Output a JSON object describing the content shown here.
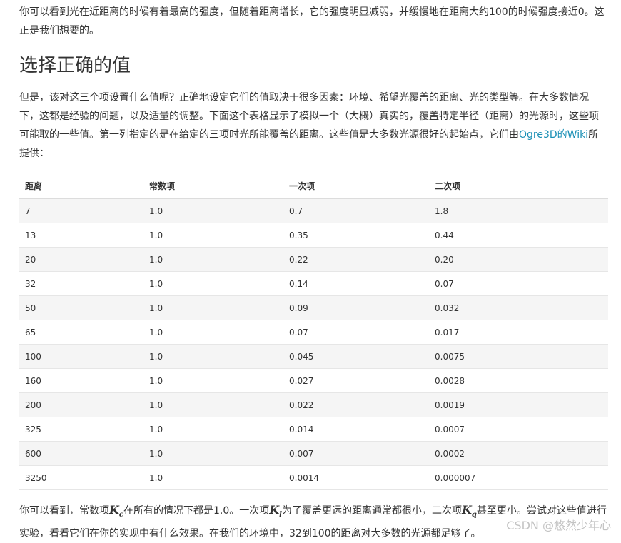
{
  "intro": "你可以看到光在近距离的时候有着最高的强度，但随着距离增长，它的强度明显减弱，并缓慢地在距离大约100的时候强度接近0。这正是我们想要的。",
  "section_title": "选择正确的值",
  "body": {
    "before_link": "但是，该对这三个项设置什么值呢？正确地设定它们的值取决于很多因素：环境、希望光覆盖的距离、光的类型等。在大多数情况下，这都是经验的问题，以及适量的调整。下面这个表格显示了模拟一个（大概）真实的，覆盖特定半径（距离）的光源时，这些项可能取的一些值。第一列指定的是在给定的三项时光所能覆盖的距离。这些值是大多数光源很好的起始点，它们由",
    "link_text": "Ogre3D的Wiki",
    "after_link": "所提供："
  },
  "table": {
    "headers": [
      "距离",
      "常数项",
      "一次项",
      "二次项"
    ],
    "rows": [
      [
        "7",
        "1.0",
        "0.7",
        "1.8"
      ],
      [
        "13",
        "1.0",
        "0.35",
        "0.44"
      ],
      [
        "20",
        "1.0",
        "0.22",
        "0.20"
      ],
      [
        "32",
        "1.0",
        "0.14",
        "0.07"
      ],
      [
        "50",
        "1.0",
        "0.09",
        "0.032"
      ],
      [
        "65",
        "1.0",
        "0.07",
        "0.017"
      ],
      [
        "100",
        "1.0",
        "0.045",
        "0.0075"
      ],
      [
        "160",
        "1.0",
        "0.027",
        "0.0028"
      ],
      [
        "200",
        "1.0",
        "0.022",
        "0.0019"
      ],
      [
        "325",
        "1.0",
        "0.014",
        "0.0007"
      ],
      [
        "600",
        "1.0",
        "0.007",
        "0.0002"
      ],
      [
        "3250",
        "1.0",
        "0.0014",
        "0.000007"
      ]
    ]
  },
  "bottom": {
    "t1": "你可以看到，常数项",
    "kc": "K",
    "kc_sub": "c",
    "t2": "在所有的情况下都是1.0。一次项",
    "kl": "K",
    "kl_sub": "l",
    "t3": "为了覆盖更远的距离通常都很小，二次项",
    "kq": "K",
    "kq_sub": "q",
    "t4": "甚至更小。尝试对这些值进行实验，看看它们在你的实现中有什么效果。在我们的环境中，32到100的距离对大多数的光源都足够了。"
  },
  "watermark": "CSDN @悠然少年心",
  "colors": {
    "link": "#1a8fb5",
    "row_alt": "#f5f5f5",
    "text": "#333333"
  }
}
